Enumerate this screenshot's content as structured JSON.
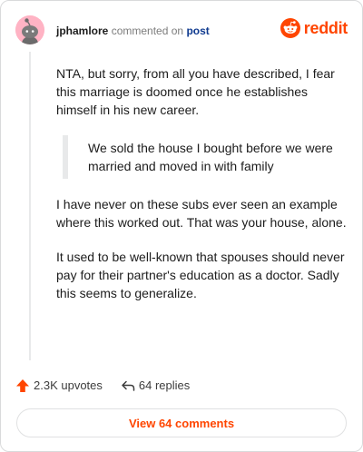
{
  "header": {
    "username": "jphamlore",
    "action": "commented on",
    "post_link": "post",
    "brand": "reddit"
  },
  "comment": {
    "paragraph_1": "NTA, but sorry, from all you have described, I fear this marriage is doomed once he establishes himself in his new career.",
    "quote": "We sold the house I bought before we were married and moved in with family",
    "paragraph_2": "I have never on these subs ever seen an example where this worked out. That was your house, alone.",
    "paragraph_3": "It used to be well-known that spouses should never pay for their partner's education as a doctor. Sadly this seems to generalize."
  },
  "footer": {
    "upvotes": "2.3K upvotes",
    "replies": "64 replies",
    "view_comments": "View 64 comments"
  },
  "icons": {
    "upvote": "upvote-arrow-icon",
    "reply": "reply-arrow-icon",
    "brand": "reddit-snoo-icon"
  },
  "colors": {
    "brand": "#ff4500",
    "link": "#0f3a8f",
    "text": "#1c1c1c",
    "muted": "#7c7c7c",
    "avatar_bg": "#ffb3c4"
  }
}
